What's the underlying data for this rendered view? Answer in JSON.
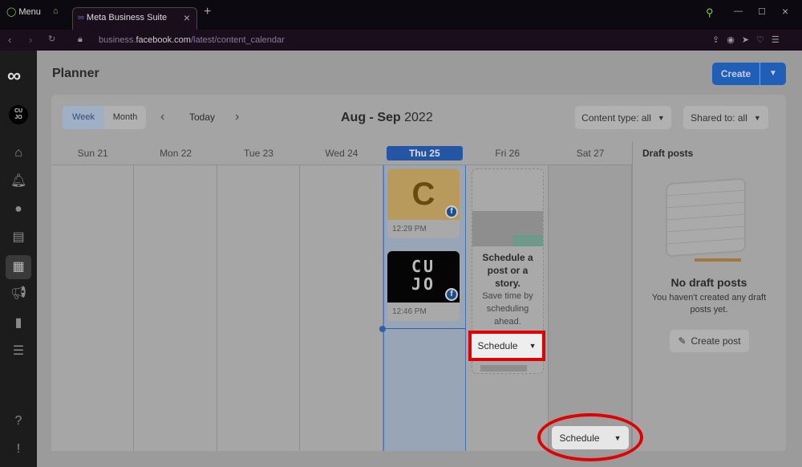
{
  "browser": {
    "menu_label": "Menu",
    "tab_title": "Meta Business Suite",
    "url_prefix": "business.",
    "url_domain": "facebook.com",
    "url_path": "/latest/content_calendar"
  },
  "header": {
    "title": "Planner",
    "create_label": "Create"
  },
  "toolbar": {
    "week": "Week",
    "month": "Month",
    "today": "Today",
    "range_bold": "Aug - Sep",
    "range_year": "2022",
    "content_type": "Content type: all",
    "shared_to": "Shared to: all"
  },
  "days": [
    "Sun 21",
    "Mon 22",
    "Tue 23",
    "Wed 24",
    "Thu 25",
    "Fri 26",
    "Sat 27"
  ],
  "posts": [
    {
      "thumb": "C",
      "time": "12:29 PM"
    },
    {
      "thumb": "CU JO",
      "time": "12:46 PM"
    }
  ],
  "promo": {
    "title": "Schedule a post or a story.",
    "body": "Save time by scheduling ahead.",
    "button": "Schedule"
  },
  "bottom_schedule": "Schedule",
  "drafts": {
    "title": "Draft posts",
    "empty_title": "No draft posts",
    "empty_body": "You haven't created any draft posts yet.",
    "create_post": "Create post"
  },
  "profile_initials": "CU JO",
  "colors": {
    "accent": "#1f5fb8",
    "highlight": "#e00000"
  }
}
